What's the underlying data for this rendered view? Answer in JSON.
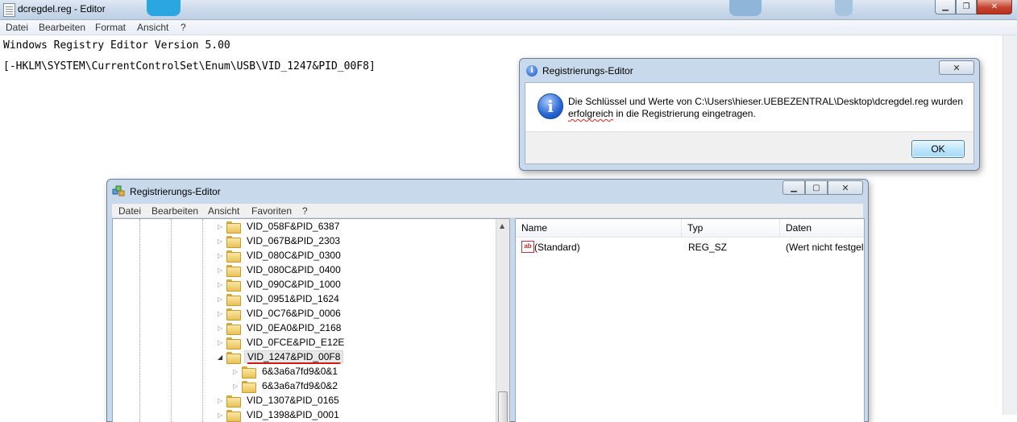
{
  "notepad": {
    "title": "dcregdel.reg - Editor",
    "menu": [
      "Datei",
      "Bearbeiten",
      "Format",
      "Ansicht",
      "?"
    ],
    "lines": [
      "Windows Registry Editor Version 5.00",
      "[-HKLM\\SYSTEM\\CurrentControlSet\\Enum\\USB\\VID_1247&PID_00F8]"
    ]
  },
  "dialog": {
    "title": "Registrierungs-Editor",
    "message_part1": "Die Schlüssel und Werte von C:\\Users\\hieser.UEBEZENTRAL\\Desktop\\dcregdel.reg wurden",
    "message_squiggle": "erfolgreich",
    "message_part2": " in die Registrierung eingetragen.",
    "ok_label": "OK",
    "info_glyph": "i"
  },
  "regedit": {
    "title": "Registrierungs-Editor",
    "menu": [
      "Datei",
      "Bearbeiten",
      "Ansicht",
      "Favoriten",
      "?"
    ],
    "tree": [
      {
        "label": "VID_058F&PID_6387",
        "indent": 1,
        "expanded": false
      },
      {
        "label": "VID_067B&PID_2303",
        "indent": 1,
        "expanded": false
      },
      {
        "label": "VID_080C&PID_0300",
        "indent": 1,
        "expanded": false
      },
      {
        "label": "VID_080C&PID_0400",
        "indent": 1,
        "expanded": false
      },
      {
        "label": "VID_090C&PID_1000",
        "indent": 1,
        "expanded": false
      },
      {
        "label": "VID_0951&PID_1624",
        "indent": 1,
        "expanded": false
      },
      {
        "label": "VID_0C76&PID_0006",
        "indent": 1,
        "expanded": false
      },
      {
        "label": "VID_0EA0&PID_2168",
        "indent": 1,
        "expanded": false
      },
      {
        "label": "VID_0FCE&PID_E12E",
        "indent": 1,
        "expanded": false
      },
      {
        "label": "VID_1247&PID_00F8",
        "indent": 1,
        "expanded": true,
        "selected": true
      },
      {
        "label": "6&3a6a7fd9&0&1",
        "indent": 2,
        "expanded": false
      },
      {
        "label": "6&3a6a7fd9&0&2",
        "indent": 2,
        "expanded": false
      },
      {
        "label": "VID_1307&PID_0165",
        "indent": 1,
        "expanded": false
      },
      {
        "label": "VID_1398&PID_0001",
        "indent": 1,
        "expanded": false
      }
    ],
    "columns": {
      "name": "Name",
      "type": "Typ",
      "data": "Daten"
    },
    "values": [
      {
        "name": "(Standard)",
        "type": "REG_SZ",
        "data": "(Wert nicht festgelegt)"
      }
    ]
  }
}
